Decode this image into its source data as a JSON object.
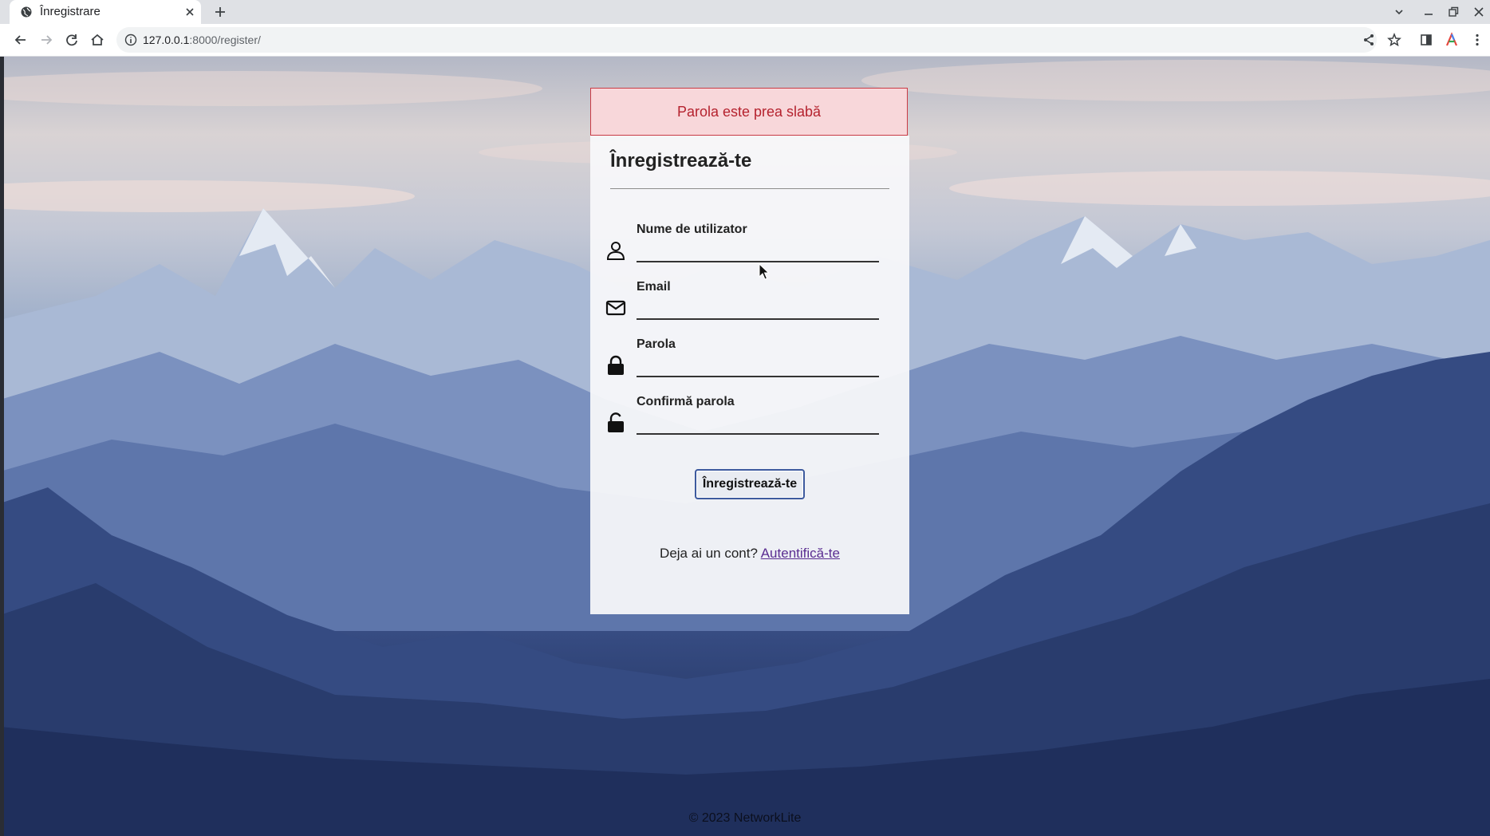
{
  "browser": {
    "tab_title": "Înregistrare",
    "url_host": "127.0.0.1",
    "url_rest": ":8000/register/"
  },
  "alert": {
    "message": "Parola este prea slabă"
  },
  "form": {
    "title": "Înregistrează-te",
    "fields": [
      {
        "label": "Nume de utilizator",
        "icon": "user-icon",
        "value": ""
      },
      {
        "label": "Email",
        "icon": "envelope-icon",
        "value": ""
      },
      {
        "label": "Parola",
        "icon": "lock-icon",
        "value": ""
      },
      {
        "label": "Confirmă parola",
        "icon": "unlock-icon",
        "value": ""
      }
    ],
    "submit_label": "Înregistrează-te",
    "signin_prompt": "Deja ai un cont?",
    "signin_link": "Autentifică-te"
  },
  "footer": {
    "text": "© 2023 NetworkLite"
  },
  "colors": {
    "alert_bg": "#f8d7da",
    "alert_text": "#b5222e",
    "link": "#5a2d91",
    "button_border": "#3d5a9e"
  }
}
